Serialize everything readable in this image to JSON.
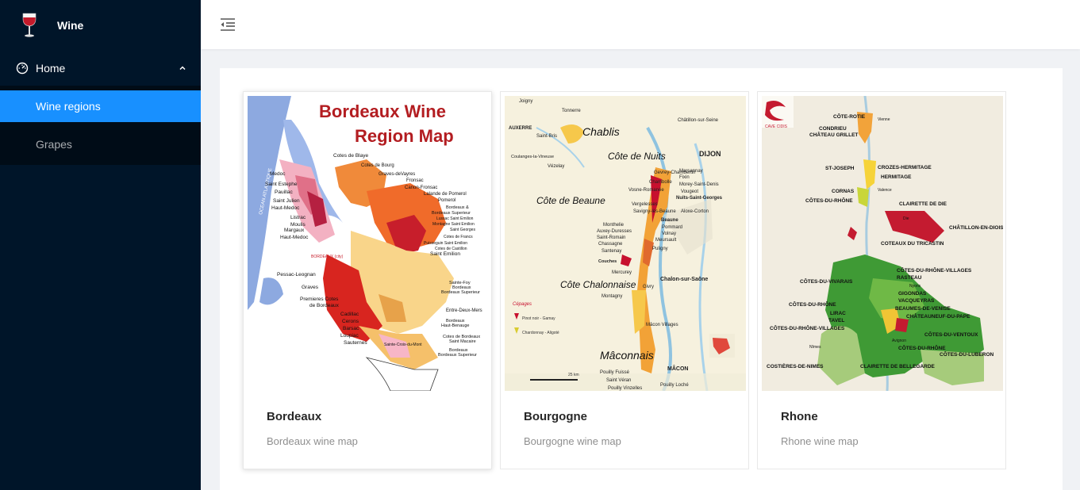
{
  "app": {
    "title": "Wine",
    "logo_icon": "wine-glass-icon"
  },
  "sidebar": {
    "menu": {
      "label": "Home",
      "icon": "dashboard-icon",
      "expanded": true,
      "items": [
        {
          "label": "Wine regions",
          "active": true
        },
        {
          "label": "Grapes",
          "active": false
        }
      ]
    }
  },
  "header": {
    "toggle_icon": "menu-fold-icon"
  },
  "cards": [
    {
      "title": "Bordeaux",
      "description": "Bordeaux wine map",
      "map": {
        "heading_line1": "Bordeaux Wine",
        "heading_line2": "Region Map",
        "labels_left": [
          "Cotes de Blaye",
          "Medoc",
          "Saint Estephe",
          "Pauillac",
          "Saint Julien",
          "Haut-Medoc",
          "Listrac",
          "Moulis",
          "Margaux",
          "Haut-Medoc",
          "Pessac-Leognan",
          "Graves",
          "Premieres Cotes",
          "de Bordeaux",
          "Cadillac",
          "Cerons",
          "Barsac",
          "Loupiac",
          "Sauternes"
        ],
        "labels_right": [
          "Cotes de Bourg",
          "Graves-deVayres",
          "Fronsac",
          "Canon-Fronsac",
          "Lalande de Pomerol",
          "Pomerol",
          "Bordeaux &",
          "Bordeaux Superieur",
          "Lussac Saint Emilion",
          "Montagne Saint Emilion",
          "Saint Georges",
          "Cotes de Francs",
          "Puisseguin Saint Emilion",
          "Cotes de Castillon",
          "Saint Emilion",
          "Sainte-Foy",
          "Bordeaux",
          "Bordeaux Superieur",
          "Entre-Deux-Mers",
          "Bordeaux",
          "Haut-Benauge",
          "Cotes de Bordeaux",
          "Saint Macaire",
          "Bordeaux",
          "Bordeaux Superieur"
        ],
        "sea_label": "OCEAN ATLANTIQUE",
        "city_label": "BORDEAUX (city)",
        "bottom_label": "Sainte-Croix-du-Mont"
      }
    },
    {
      "title": "Bourgogne",
      "description": "Bourgogne wine map",
      "map": {
        "region_labels": [
          "Chablis",
          "Côte de Nuits",
          "Côte de Beaune",
          "Côte Chalonnaise",
          "Mâconnais"
        ],
        "towns": [
          "Joigny",
          "Tonnerre",
          "AUXERRE",
          "Saint-Bris",
          "Coulanges-la-Vineuse",
          "Vézelay",
          "Châtillon-sur-Seine",
          "DIJON",
          "Marsannay",
          "Fixin",
          "Gevrey-Chambertin",
          "Morey-Saint-Denis",
          "Chambolle",
          "Vougeot",
          "Vosne-Romanée",
          "Nuits-Saint-Georges",
          "Vergelesses",
          "Savigny-lès-Beaune",
          "Aloxe-Corton",
          "Beaune",
          "Pommard",
          "Volnay",
          "Meursault",
          "Monthelie",
          "Auxey-Duresses",
          "Saint-Romain",
          "Chassagne",
          "Santenay",
          "Puligny",
          "Couches",
          "Mercurey",
          "Chalon-sur-Saône",
          "Givry",
          "Montagny",
          "Mâcon Villages",
          "Pouilly Fuissé",
          "Saint Véran",
          "Pouilly Vinzelles",
          "MÂCON",
          "Pouilly Loché"
        ],
        "legend_title": "Cépages",
        "legend_items": [
          "Pinot noir - Gamay",
          "Chardonnay - Aligoté"
        ],
        "scale": "25 km"
      }
    },
    {
      "title": "Rhone",
      "description": "Rhone wine map",
      "map": {
        "brand": "CAVE CIDIS",
        "labels": [
          "CÔTE-ROTIE",
          "CONDRIEU",
          "CHÂTEAU GRILLET",
          "Vienne",
          "ST-JOSEPH",
          "CROZES-HERMITAGE",
          "HERMITAGE",
          "CORNAS",
          "Valence",
          "CÔTES-DU-RHÔNE",
          "CLAIRETTE DE DIE",
          "Die",
          "CHÂTILLON-EN-DIOIS",
          "COTEAUX DU TRICASTIN",
          "CÔTES-DU-RHÔNE-VILLAGES",
          "RASTEAU",
          "CÔTES-DU-VIVARAIS",
          "Nyons",
          "GIGONDAS",
          "VACQUEYRAS",
          "BEAUMES-DE-VENISE",
          "CÔTES-DU-RHÔNE",
          "LIRAC",
          "TAVEL",
          "CHÂTEAUNEUF-DU-PAPE",
          "CÔTES-DU-RHÔNE-VILLAGES",
          "CÔTES-DU-VENTOUX",
          "Avignon",
          "Nîmes",
          "CÔTES-DU-RHÔNE",
          "CÔTES-DU-LUBERON",
          "COSTIÈRES-DE-NIMES",
          "CLAIRETTE DE BELLEGARDE"
        ]
      }
    }
  ]
}
